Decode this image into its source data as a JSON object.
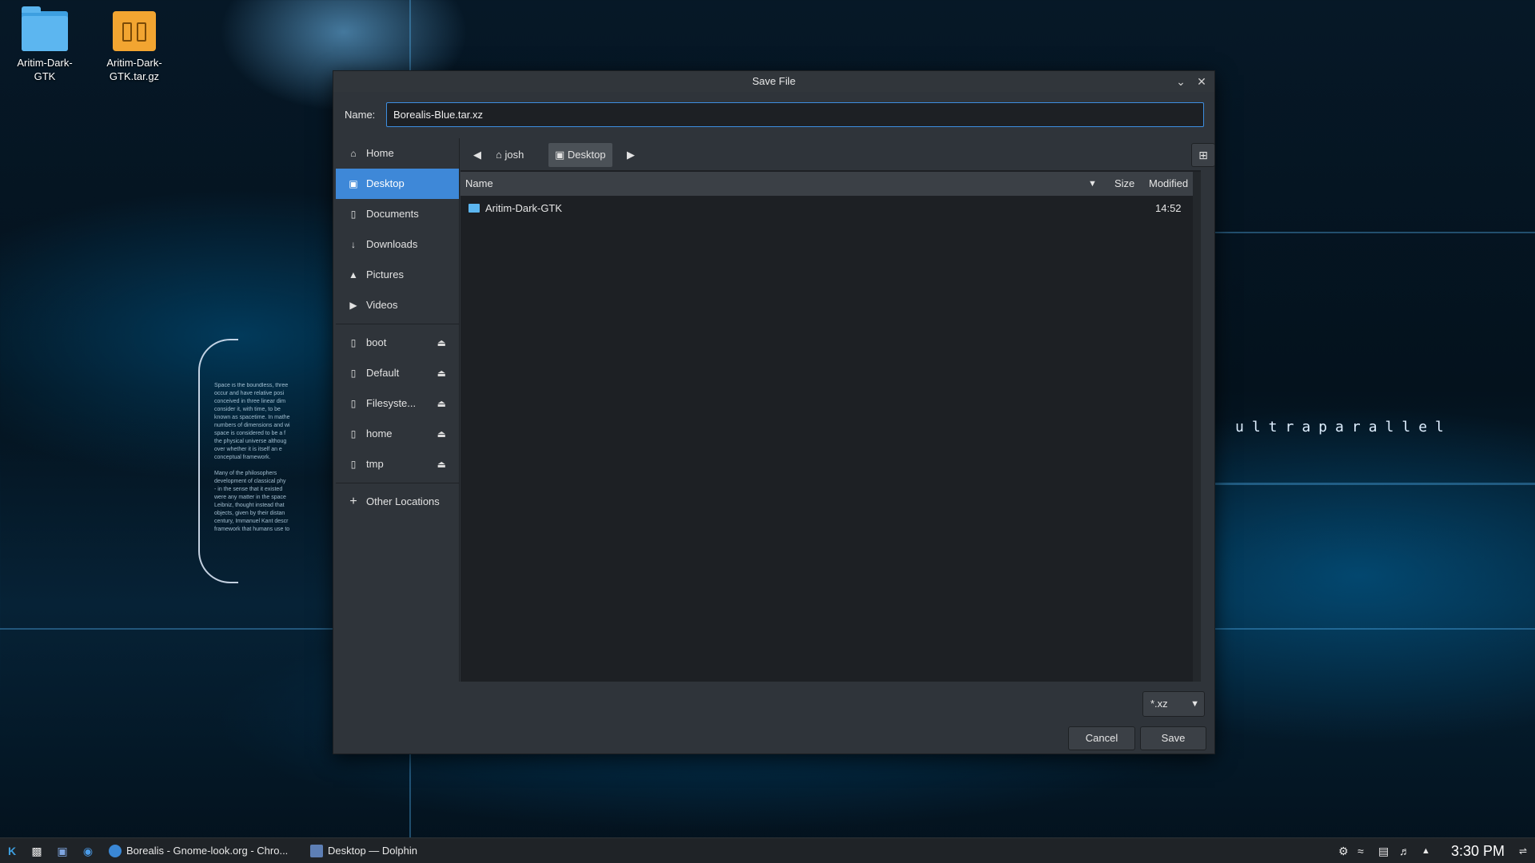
{
  "desktop": {
    "icons": [
      {
        "label": "Aritim-Dark-GTK",
        "type": "folder"
      },
      {
        "label": "Aritim-Dark-GTK.tar.gz",
        "type": "archive"
      }
    ],
    "wallpaper_text": "ultraparallel",
    "wallpaper_paragraph": "Space is the boundless, three\noccur and have relative posi\nconceived in three linear dim\nconsider it, with time, to be\nknown as spacetime. In mathe\nnumbers of dimensions and wi\nspace is considered to be a f\nthe physical universe althoug\nover whether it is itself an e\nconceptual framework.\n\nMany of the philosophers\ndevelopment of classical phy\n- in the sense that it existed\nwere any matter in the space\nLeibniz, thought instead that\nobjects, given by their distan\ncentury, Immanuel Kant descr\nframework that humans use to"
  },
  "dialog": {
    "title": "Save File",
    "name_label": "Name:",
    "name_value": "Borealis-Blue.tar.xz",
    "sidebar": {
      "places": [
        {
          "label": "Home",
          "icon": "home-icon",
          "active": false
        },
        {
          "label": "Desktop",
          "icon": "desktop-icon",
          "active": true
        },
        {
          "label": "Documents",
          "icon": "document-icon",
          "active": false
        },
        {
          "label": "Downloads",
          "icon": "download-icon",
          "active": false
        },
        {
          "label": "Pictures",
          "icon": "picture-icon",
          "active": false
        },
        {
          "label": "Videos",
          "icon": "video-icon",
          "active": false
        }
      ],
      "devices": [
        {
          "label": "boot"
        },
        {
          "label": "Default"
        },
        {
          "label": "Filesyste..."
        },
        {
          "label": "home"
        },
        {
          "label": "tmp"
        }
      ],
      "other": "Other Locations"
    },
    "pathbar": {
      "segments": [
        "josh",
        "Desktop"
      ],
      "active": "Desktop"
    },
    "columns": {
      "name": "Name",
      "size": "Size",
      "modified": "Modified"
    },
    "files": [
      {
        "name": "Aritim-Dark-GTK",
        "size": "",
        "modified": "14:52",
        "type": "folder"
      }
    ],
    "filter": "*.xz",
    "cancel_label": "Cancel",
    "save_label": "Save"
  },
  "taskbar": {
    "tasks": [
      {
        "label": "Borealis - Gnome-look.org - Chro..."
      },
      {
        "label": "Desktop — Dolphin"
      }
    ],
    "clock": "3:30 PM"
  },
  "colors": {
    "accent": "#3e88d8",
    "dialog_bg": "#2f343a",
    "view_bg": "#1d2024"
  }
}
